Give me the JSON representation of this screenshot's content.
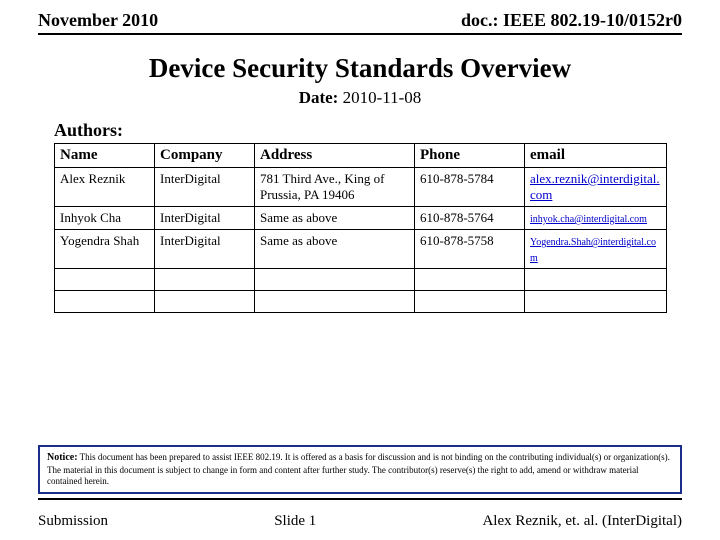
{
  "header": {
    "left": "November 2010",
    "right": "doc.: IEEE 802.19-10/0152r0"
  },
  "title": "Device Security Standards Overview",
  "date_label": "Date:",
  "date_value": " 2010-11-08",
  "authors_label": "Authors:",
  "table": {
    "headers": [
      "Name",
      "Company",
      "Address",
      "Phone",
      "email"
    ],
    "rows": [
      {
        "name": "Alex Reznik",
        "company": "InterDigital",
        "address": "781 Third Ave., King of Prussia, PA 19406",
        "phone": "610-878-5784",
        "email": "alex.reznik@interdigital.com",
        "email_small": false
      },
      {
        "name": "Inhyok Cha",
        "company": "InterDigital",
        "address": "Same as above",
        "phone": "610-878-5764",
        "email": "inhyok.cha@interdigital.com",
        "email_small": true
      },
      {
        "name": "Yogendra Shah",
        "company": "InterDigital",
        "address": "Same as above",
        "phone": "610-878-5758",
        "email": "Yogendra.Shah@interdigital.com",
        "email_small": true
      }
    ]
  },
  "notice": {
    "label": "Notice:",
    "text": " This document has been prepared to assist IEEE 802.19. It is offered as a basis for discussion and is not binding on the contributing individual(s) or organization(s). The material in this document is subject to change in form and content after further study. The contributor(s) reserve(s) the right to add, amend or withdraw material contained herein."
  },
  "footer": {
    "left": "Submission",
    "center": "Slide 1",
    "right": "Alex Reznik, et. al. (InterDigital)"
  }
}
